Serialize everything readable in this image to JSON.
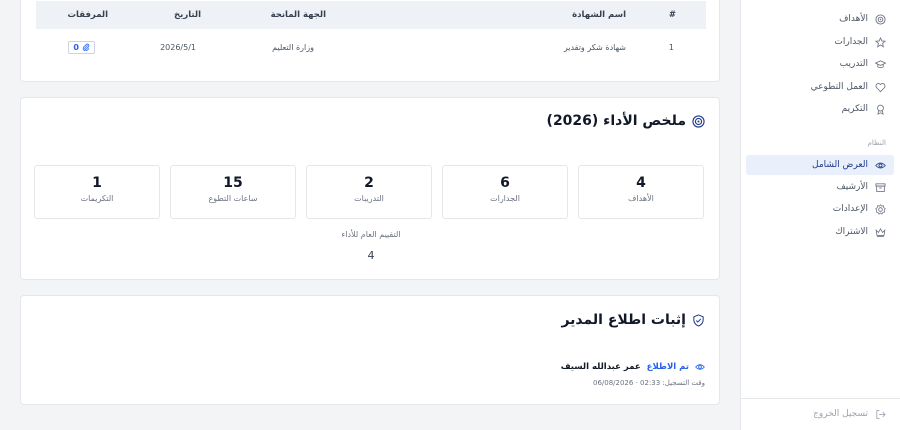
{
  "sidebar": {
    "top_items": [
      {
        "label": "الأهداف",
        "icon": "target-icon"
      },
      {
        "label": "الجدارات",
        "icon": "star-icon"
      },
      {
        "label": "التدريب",
        "icon": "graduation-cap-icon"
      },
      {
        "label": "العمل التطوعي",
        "icon": "heart-icon"
      },
      {
        "label": "التكريم",
        "icon": "award-icon"
      }
    ],
    "section_label": "النظام",
    "system_items": [
      {
        "label": "العرض الشامل",
        "icon": "eye-icon",
        "active": true
      },
      {
        "label": "الأرشيف",
        "icon": "archive-icon"
      },
      {
        "label": "الإعدادات",
        "icon": "gear-icon"
      },
      {
        "label": "الاشتراك",
        "icon": "crown-icon"
      }
    ],
    "logout_label": "تسجيل الخروج"
  },
  "certificates": {
    "headers": {
      "num": "#",
      "name": "اسم الشهادة",
      "issuer": "الجهة المانحة",
      "date": "التاريخ",
      "attachments": "المرفقات"
    },
    "rows": [
      {
        "num": "1",
        "name": "شهادة شكر وتقدير",
        "issuer": "وزارة التعليم",
        "date": "2026/5/1",
        "attachments": "0"
      }
    ]
  },
  "summary": {
    "title": "ملخص الأداء (2026)",
    "stats": [
      {
        "value": "4",
        "label": "الأهداف"
      },
      {
        "value": "6",
        "label": "الجدارات"
      },
      {
        "value": "2",
        "label": "التدريبات"
      },
      {
        "value": "15",
        "label": "ساعات التطوع"
      },
      {
        "value": "1",
        "label": "التكريمات"
      }
    ],
    "overall_label": "التقييم العام للأداء",
    "overall_value": "4"
  },
  "acknowledgement": {
    "title": "إثبات اطلاع المدير",
    "status": "تم الاطلاع",
    "manager": "عمر عبدالله السيف",
    "timestamp": "وقت التسجيل: 02:33 · 06/08/2026"
  },
  "colors": {
    "accent": "#2563eb",
    "active_bg": "#eaf0fb",
    "page_bg": "#f3f4f6"
  }
}
